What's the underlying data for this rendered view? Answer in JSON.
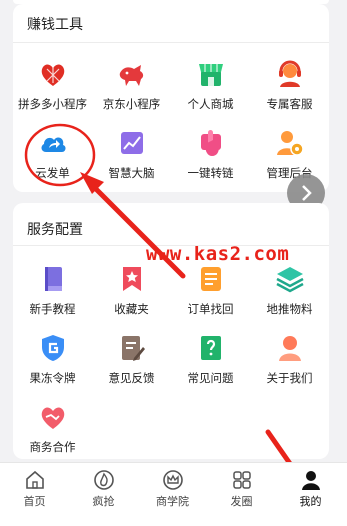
{
  "earn_tools": {
    "title": "赚钱工具",
    "items": [
      {
        "label": "拼多多小程序",
        "icon": "pinduoduo-icon"
      },
      {
        "label": "京东小程序",
        "icon": "jd-dog-icon"
      },
      {
        "label": "个人商城",
        "icon": "shop-icon"
      },
      {
        "label": "专属客服",
        "icon": "customer-service-icon"
      },
      {
        "label": "云发单",
        "icon": "cloud-share-icon"
      },
      {
        "label": "智慧大脑",
        "icon": "chart-icon"
      },
      {
        "label": "一键转链",
        "icon": "tap-icon"
      },
      {
        "label": "管理后台",
        "icon": "admin-gear-icon"
      }
    ]
  },
  "service_config": {
    "title": "服务配置",
    "items": [
      {
        "label": "新手教程",
        "icon": "book-icon"
      },
      {
        "label": "收藏夹",
        "icon": "favorites-icon"
      },
      {
        "label": "订单找回",
        "icon": "order-icon"
      },
      {
        "label": "地推物料",
        "icon": "layers-icon"
      },
      {
        "label": "果冻令牌",
        "icon": "shield-g-icon"
      },
      {
        "label": "意见反馈",
        "icon": "feedback-icon"
      },
      {
        "label": "常见问题",
        "icon": "question-icon"
      },
      {
        "label": "关于我们",
        "icon": "about-person-icon"
      },
      {
        "label": "商务合作",
        "icon": "handshake-heart-icon"
      }
    ]
  },
  "watermark": "www.kas2.com",
  "tabbar": {
    "items": [
      {
        "label": "首页",
        "icon": "home-icon",
        "active": false
      },
      {
        "label": "疯抢",
        "icon": "flame-icon",
        "active": false
      },
      {
        "label": "商学院",
        "icon": "crown-icon",
        "active": false
      },
      {
        "label": "发圈",
        "icon": "grid-icon",
        "active": false
      },
      {
        "label": "我的",
        "icon": "person-icon",
        "active": true
      }
    ]
  },
  "colors": {
    "annotation_red": "#e8231b",
    "active_tab": "#111111",
    "inactive_tab": "#555555"
  }
}
